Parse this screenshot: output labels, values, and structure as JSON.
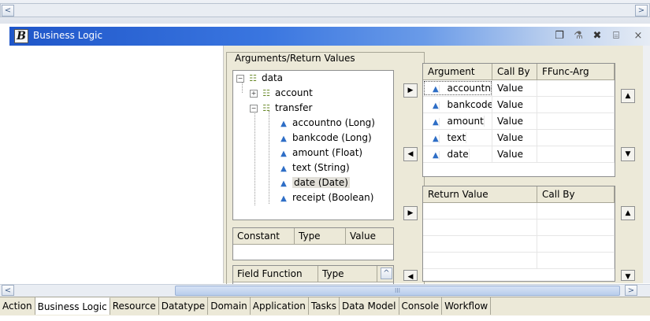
{
  "window": {
    "title": "Business Logic",
    "logo_letter": "B",
    "toolbar_icons": [
      "new-document-icon",
      "hierarchy-icon",
      "delete-icon",
      "properties-icon",
      "close-icon"
    ],
    "close_glyph": "×"
  },
  "top_scroll": {
    "left_arrow": "<",
    "right_arrow": ">"
  },
  "arguments_group": {
    "legend": "Arguments/Return Values",
    "tree": [
      {
        "label": "data",
        "icon": "structure-icon",
        "expander": "−"
      },
      {
        "label": "account",
        "icon": "structure-icon",
        "expander": "+"
      },
      {
        "label": "transfer",
        "icon": "structure-icon",
        "expander": "−"
      },
      {
        "label": "accountno (Long)",
        "icon": "field-icon"
      },
      {
        "label": "bankcode (Long)",
        "icon": "field-icon"
      },
      {
        "label": "amount (Float)",
        "icon": "field-icon"
      },
      {
        "label": "text (String)",
        "icon": "field-icon"
      },
      {
        "label": "date (Date)",
        "icon": "field-icon",
        "selected": true
      },
      {
        "label": "receipt (Boolean)",
        "icon": "field-icon"
      }
    ],
    "constant_table": {
      "headers": [
        "Constant",
        "Type",
        "Value"
      ]
    },
    "field_function_table": {
      "headers": [
        "Field Function",
        "Type"
      ]
    }
  },
  "argument_table": {
    "headers": [
      "Argument",
      "Call By",
      "FFunc-Arg"
    ],
    "rows": [
      {
        "argument": "accountno",
        "call_by": "Value",
        "ffunc_arg": ""
      },
      {
        "argument": "bankcode",
        "call_by": "Value",
        "ffunc_arg": ""
      },
      {
        "argument": "amount",
        "call_by": "Value",
        "ffunc_arg": ""
      },
      {
        "argument": "text",
        "call_by": "Value",
        "ffunc_arg": ""
      },
      {
        "argument": "date",
        "call_by": "Value",
        "ffunc_arg": ""
      }
    ]
  },
  "return_table": {
    "headers": [
      "Return Value",
      "Call By"
    ]
  },
  "buttons": {
    "add_arrow": "▶",
    "remove_arrow": "◀",
    "move_up": "▲",
    "move_down": "▼"
  },
  "bottom_scroll": {
    "left_arrow": "<",
    "right_arrow": ">",
    "thumb_grip": "III"
  },
  "tabs": [
    "Action",
    "Business Logic",
    "Resource",
    "Datatype",
    "Domain",
    "Application",
    "Tasks",
    "Data Model",
    "Console",
    "Workflow"
  ],
  "active_tab": "Business Logic"
}
